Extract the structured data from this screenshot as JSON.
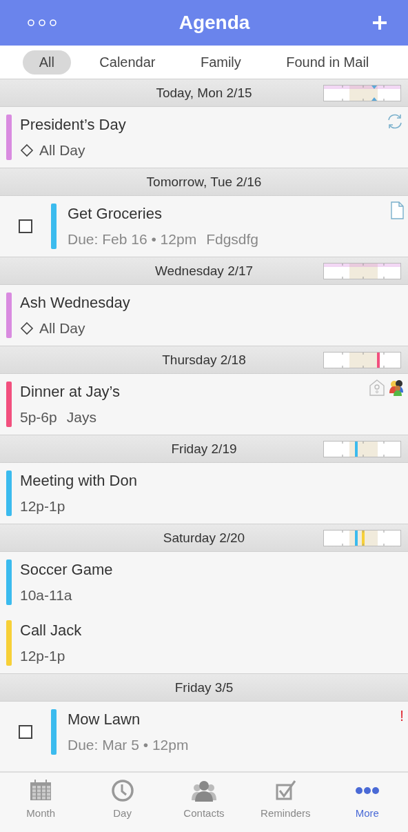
{
  "nav_bar": {
    "title": "Agenda"
  },
  "filters": [
    {
      "label": "All",
      "selected": true
    },
    {
      "label": "Calendar",
      "selected": false
    },
    {
      "label": "Family",
      "selected": false
    },
    {
      "label": "Found in Mail",
      "selected": false
    }
  ],
  "sections": [
    {
      "header": "Today, Mon 2/15",
      "day_strip": true,
      "items": [
        {
          "kind": "allday",
          "title": "President’s Day",
          "when": "All Day",
          "color": "#d98be0",
          "repeats": true
        }
      ]
    },
    {
      "header": "Tomorrow, Tue 2/16",
      "day_strip": false,
      "items": [
        {
          "kind": "reminder",
          "title": "Get Groceries",
          "when": "Due: Feb 16 • 12pm",
          "location": "Fdgsdfg",
          "color": "#3bbbee",
          "checked": false,
          "has_note": true
        }
      ]
    },
    {
      "header": "Wednesday 2/17",
      "day_strip": true,
      "items": [
        {
          "kind": "allday",
          "title": "Ash Wednesday",
          "when": "All Day",
          "color": "#d98be0"
        }
      ]
    },
    {
      "header": "Thursday 2/18",
      "day_strip": true,
      "items": [
        {
          "kind": "timed",
          "title": "Dinner at Jay’s",
          "when": "5p-6p",
          "location": "Jays",
          "color": "#f2507e",
          "alarm": true,
          "shared": true
        }
      ]
    },
    {
      "header": "Friday 2/19",
      "day_strip": true,
      "items": [
        {
          "kind": "timed",
          "title": "Meeting with Don",
          "when": "12p-1p",
          "color": "#3bbbee"
        }
      ]
    },
    {
      "header": "Saturday 2/20",
      "day_strip": true,
      "items": [
        {
          "kind": "timed",
          "title": "Soccer Game",
          "when": "10a-11a",
          "color": "#3bbbee"
        },
        {
          "kind": "timed",
          "title": "Call Jack",
          "when": "12p-1p",
          "color": "#f7d038"
        }
      ]
    },
    {
      "header": "Friday 3/5",
      "day_strip": false,
      "items": [
        {
          "kind": "reminder",
          "title": "Mow Lawn",
          "when": "Due: Mar 5 • 12pm",
          "color": "#3bbbee",
          "checked": false,
          "priority": "!"
        }
      ]
    }
  ],
  "tab_bar": [
    {
      "label": "Month",
      "selected": false
    },
    {
      "label": "Day",
      "selected": false
    },
    {
      "label": "Contacts",
      "selected": false
    },
    {
      "label": "Reminders",
      "selected": false
    },
    {
      "label": "More",
      "selected": true
    }
  ]
}
